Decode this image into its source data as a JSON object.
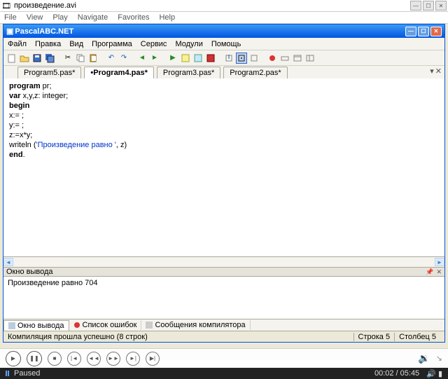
{
  "outer": {
    "title": "произведение.avi",
    "menu": [
      "File",
      "View",
      "Play",
      "Navigate",
      "Favorites",
      "Help"
    ]
  },
  "inner": {
    "title": "PascalABC.NET",
    "menu": [
      "Файл",
      "Правка",
      "Вид",
      "Программа",
      "Сервис",
      "Модули",
      "Помощь"
    ]
  },
  "tabs": [
    {
      "label": "Program5.pas*",
      "active": false
    },
    {
      "label": "•Program4.pas*",
      "active": true
    },
    {
      "label": "Program3.pas*",
      "active": false
    },
    {
      "label": "Program2.pas*",
      "active": false
    }
  ],
  "code": {
    "l1a": "program",
    "l1b": " pr;",
    "l2a": "var",
    "l2b": " x,y,z: integer;",
    "l3": "begin",
    "l4": "x:= ;",
    "l5": "y:= ;",
    "l6": "z:=x*y;",
    "l7a": "writeln (",
    "l7b": "'Произведение равно '",
    "l7c": ", z)",
    "l8a": "end",
    "l8b": "."
  },
  "output_panel": {
    "title": "Окно вывода",
    "text": "Произведение равно 704"
  },
  "output_tabs": {
    "t1": "Окно вывода",
    "t2": "Список ошибок",
    "t3": "Сообщения компилятора"
  },
  "status": {
    "msg": "Компиляция прошла успешно (8 строк)",
    "line": "Строка  5",
    "col": "Столбец  5"
  },
  "player": {
    "state": "Paused",
    "time": "00:02 / 05:45"
  }
}
